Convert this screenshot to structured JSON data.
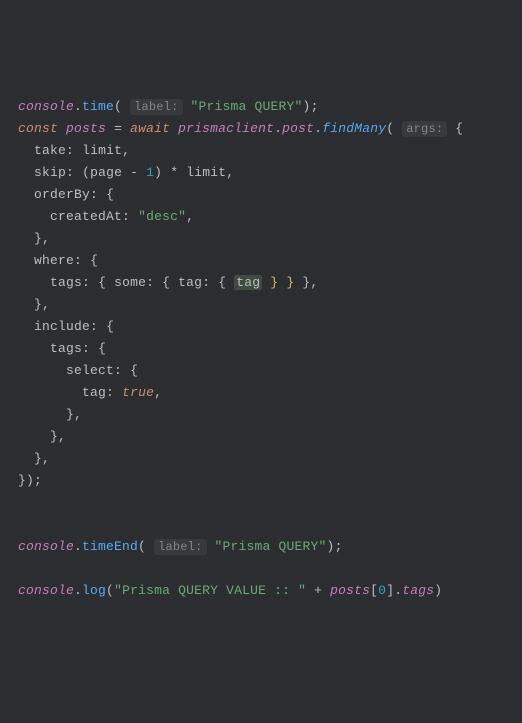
{
  "line1": {
    "console": "console",
    "dot": ".",
    "time": "time",
    "lp": "(",
    "hint": "label:",
    "str": "\"Prisma QUERY\"",
    "rp": ")",
    "sc": ";"
  },
  "line2": {
    "const": "const",
    "posts": "posts",
    "eq": "=",
    "await": "await",
    "prismaclient": "prismaclient",
    "dot1": ".",
    "post": "post",
    "dot2": ".",
    "findMany": "findMany",
    "lp": "(",
    "hint": "args:",
    "lb": "{"
  },
  "line3": {
    "take": "take",
    "c": ":",
    "limit": "limit",
    "comma": ","
  },
  "line4": {
    "skip": "skip",
    "c": ":",
    "lp": "(",
    "page": "page",
    "minus": "-",
    "one": "1",
    "rp": ")",
    "star": "*",
    "limit": "limit",
    "comma": ","
  },
  "line5": {
    "orderBy": "orderBy",
    "c": ":",
    "lb": "{"
  },
  "line6": {
    "createdAt": "createdAt",
    "c": ":",
    "str": "\"desc\"",
    "comma": ","
  },
  "line7": {
    "rb": "}",
    "comma": ","
  },
  "line8": {
    "where": "where",
    "c": ":",
    "lb": "{"
  },
  "line9": {
    "tags": "tags",
    "c1": ":",
    "lb1": "{",
    "some": "some",
    "c2": ":",
    "lb2": "{",
    "tag": "tag",
    "c3": ":",
    "lb3": "{",
    "tagv": "tag",
    "rb3": "}",
    "rb2": "}",
    "rb1": "}",
    "comma": ","
  },
  "line10": {
    "rb": "}",
    "comma": ","
  },
  "line11": {
    "include": "include",
    "c": ":",
    "lb": "{"
  },
  "line12": {
    "tags": "tags",
    "c": ":",
    "lb": "{"
  },
  "line13": {
    "select": "select",
    "c": ":",
    "lb": "{"
  },
  "line14": {
    "tag": "tag",
    "c": ":",
    "true": "true",
    "comma": ","
  },
  "line15": {
    "rb": "}",
    "comma": ","
  },
  "line16": {
    "rb": "}",
    "comma": ","
  },
  "line17": {
    "rb": "}",
    "comma": ","
  },
  "line18": {
    "rb": "}",
    "rp": ")",
    "sc": ";"
  },
  "line19": {
    "console": "console",
    "dot": ".",
    "timeEnd": "timeEnd",
    "lp": "(",
    "hint": "label:",
    "str": "\"Prisma QUERY\"",
    "rp": ")",
    "sc": ";"
  },
  "line20": {
    "console": "console",
    "dot": ".",
    "log": "log",
    "lp": "(",
    "str": "\"Prisma QUERY VALUE :: \"",
    "plus": "+",
    "posts": "posts",
    "lb": "[",
    "zero": "0",
    "rb": "]",
    "dot2": ".",
    "tags": "tags",
    "rp": ")"
  }
}
